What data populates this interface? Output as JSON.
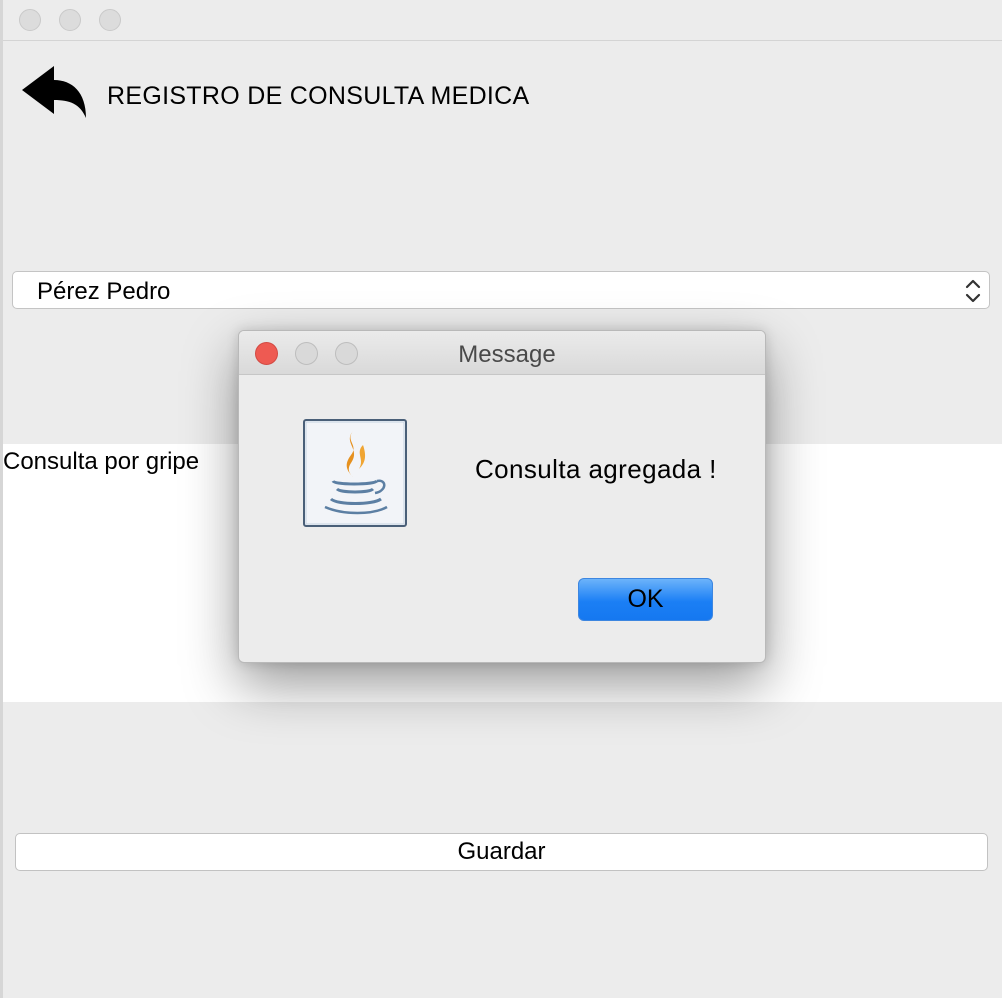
{
  "window": {
    "controls": [
      "close",
      "minimize",
      "zoom"
    ]
  },
  "header": {
    "back_icon": "back-arrow-icon",
    "title": "REGISTRO DE CONSULTA MEDICA"
  },
  "patient_select": {
    "selected": "Pérez Pedro",
    "arrow_icon": "updown-chevron-icon"
  },
  "notes": {
    "text": "Consulta por gripe"
  },
  "save_button": {
    "label": "Guardar"
  },
  "dialog": {
    "title": "Message",
    "icon": "java-icon",
    "message": "Consulta agregada !",
    "ok_label": "OK",
    "colors": {
      "close": "#ee5a52",
      "ok_button": "#1b7ff5"
    }
  }
}
